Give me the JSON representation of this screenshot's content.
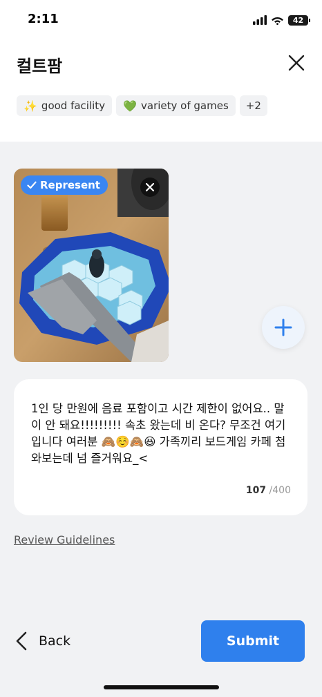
{
  "status_bar": {
    "time": "2:11",
    "battery": "42"
  },
  "header": {
    "title": "컬트팜"
  },
  "tags": [
    {
      "icon": "sparkles-icon",
      "emoji": "✨",
      "label": "good facility"
    },
    {
      "icon": "green-heart-icon",
      "emoji": "💚",
      "label": "variety of games"
    }
  ],
  "tags_more": "+2",
  "photo": {
    "badge": "Represent"
  },
  "review": {
    "text": "1인 당 만원에 음료 포함이고 시간 제한이 없어요.. 말이 안 돼요!!!!!!!!! 속초 왔는데 비 온다? 무조건 여기입니다 여러분 🙈☺️🙈😆 가족끼리 보드게임 카페 첨 와보는데 넘 즐거워요_<",
    "count": "107",
    "max": " /400"
  },
  "links": {
    "guidelines": "Review Guidelines"
  },
  "footer": {
    "back": "Back",
    "submit": "Submit"
  },
  "colors": {
    "accent": "#2f80ed",
    "badge": "#3a86f2",
    "background": "#f1f2f4"
  }
}
